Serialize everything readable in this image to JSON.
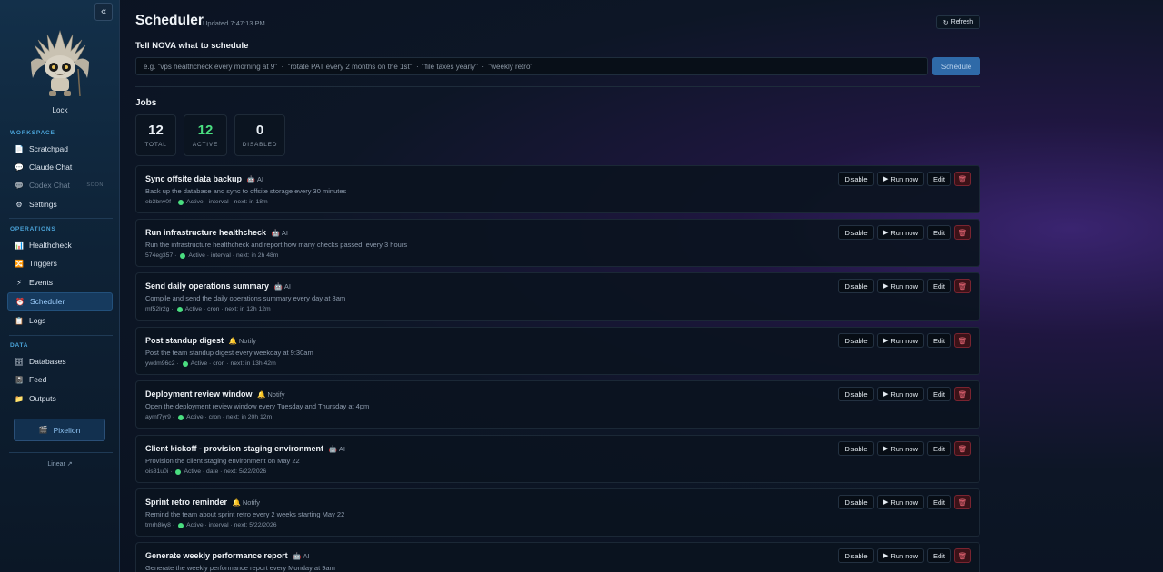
{
  "sidebar": {
    "collapse_label": "«",
    "user_name": "Lock",
    "sections": [
      {
        "label": "WORKSPACE",
        "items": [
          {
            "label": "Scratchpad",
            "icon": "notepad-icon"
          },
          {
            "label": "Claude Chat",
            "icon": "chat-bubble-icon"
          },
          {
            "label": "Codex Chat",
            "icon": "chat-bubble-icon",
            "badge": "SOON",
            "disabled": true
          },
          {
            "label": "Settings",
            "icon": "gear-icon"
          }
        ]
      },
      {
        "label": "OPERATIONS",
        "items": [
          {
            "label": "Healthcheck",
            "icon": "chart-icon"
          },
          {
            "label": "Triggers",
            "icon": "shuffle-icon"
          },
          {
            "label": "Events",
            "icon": "bolt-icon"
          },
          {
            "label": "Scheduler",
            "icon": "alarm-clock-icon",
            "active": true
          },
          {
            "label": "Logs",
            "icon": "clipboard-icon"
          }
        ]
      },
      {
        "label": "DATA",
        "items": [
          {
            "label": "Databases",
            "icon": "database-icon"
          },
          {
            "label": "Feed",
            "icon": "book-icon"
          },
          {
            "label": "Outputs",
            "icon": "folder-icon"
          }
        ]
      }
    ],
    "pixelion_label": "Pixelion",
    "linear_label": "Linear ↗"
  },
  "header": {
    "title": "Scheduler",
    "updated": "Updated 7:47:13 PM",
    "refresh_label": "Refresh"
  },
  "prompt": {
    "heading": "Tell NOVA what to schedule",
    "placeholder": "e.g. \"vps healthcheck every morning at 9\"  ·  \"rotate PAT every 2 months on the 1st\"  ·  \"file taxes yearly\"  ·  \"weekly retro\"",
    "button_label": "Schedule"
  },
  "jobs": {
    "heading": "Jobs",
    "stats": [
      {
        "value": "12",
        "label": "TOTAL"
      },
      {
        "value": "12",
        "label": "ACTIVE"
      },
      {
        "value": "0",
        "label": "DISABLED"
      }
    ],
    "buttons": {
      "disable": "Disable",
      "run": "Run now",
      "edit": "Edit",
      "delete": "🗑"
    },
    "colors": {
      "active_dot": "#4ade80",
      "delete_red": "#f26b7a",
      "accent": "#2f6aa8"
    },
    "items": [
      {
        "title": "Sync offsite data backup",
        "tag_icon": "robot-icon",
        "tag": "AI",
        "desc": "Back up the database and sync to offsite storage every 30 minutes",
        "id": "eb3bnv0f",
        "status": "Active",
        "kind": "interval",
        "next": "next: in 18m"
      },
      {
        "title": "Run infrastructure healthcheck",
        "tag_icon": "robot-icon",
        "tag": "AI",
        "desc": "Run the infrastructure healthcheck and report how many checks passed, every 3 hours",
        "id": "574eg357",
        "status": "Active",
        "kind": "interval",
        "next": "next: in 2h 48m"
      },
      {
        "title": "Send daily operations summary",
        "tag_icon": "robot-icon",
        "tag": "AI",
        "desc": "Compile and send the daily operations summary every day at 8am",
        "id": "mf52lr2g",
        "status": "Active",
        "kind": "cron",
        "next": "next: in 12h 12m"
      },
      {
        "title": "Post standup digest",
        "tag_icon": "bell-icon",
        "tag": "Notify",
        "desc": "Post the team standup digest every weekday at 9:30am",
        "id": "ywdm96c2",
        "status": "Active",
        "kind": "cron",
        "next": "next: in 13h 42m"
      },
      {
        "title": "Deployment review window",
        "tag_icon": "bell-icon",
        "tag": "Notify",
        "desc": "Open the deployment review window every Tuesday and Thursday at 4pm",
        "id": "aymf7yr9",
        "status": "Active",
        "kind": "cron",
        "next": "next: in 20h 12m"
      },
      {
        "title": "Client kickoff - provision staging environment",
        "tag_icon": "robot-icon",
        "tag": "AI",
        "desc": "Provision the client staging environment on May 22",
        "id": "ois31u0i",
        "status": "Active",
        "kind": "date",
        "next": "next: 5/22/2026"
      },
      {
        "title": "Sprint retro reminder",
        "tag_icon": "bell-icon",
        "tag": "Notify",
        "desc": "Remind the team about sprint retro every 2 weeks starting May 22",
        "id": "tmrh8ky8",
        "status": "Active",
        "kind": "interval",
        "next": "next: 5/22/2026"
      },
      {
        "title": "Generate weekly performance report",
        "tag_icon": "robot-icon",
        "tag": "AI",
        "desc": "Generate the weekly performance report every Monday at 9am",
        "id": "",
        "status": "",
        "kind": "",
        "next": ""
      }
    ]
  }
}
